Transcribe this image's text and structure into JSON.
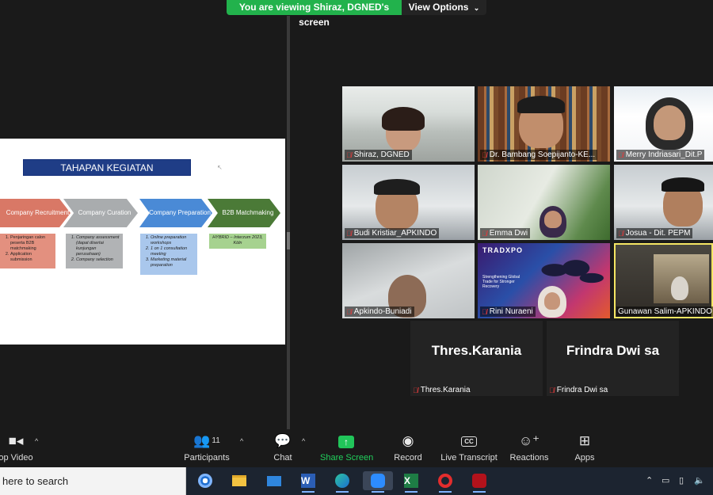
{
  "banner": {
    "viewing_text": "You are viewing Shiraz, DGNED's screen",
    "view_options": "View Options"
  },
  "slide": {
    "title": "TAHAPAN KEGIATAN",
    "steps": [
      {
        "label": "Company Recruitment",
        "color": "#d97866"
      },
      {
        "label": "Company Curation",
        "color": "#a9acae"
      },
      {
        "label": "Company Preparation",
        "color": "#4a8ad6"
      },
      {
        "label": "B2B Matchmaking",
        "color": "#4b7a37"
      }
    ],
    "step1_items": [
      "Penjaringan calon peserta B2B matchmaking",
      "Application submission"
    ],
    "step2_items": [
      "Company assessment (dapat disertai kunjungan perusahaan)",
      "Company selection"
    ],
    "step3_items": [
      "Online preparation workshops",
      "1 on 1 consultation meeting",
      "Marketing material preparation"
    ],
    "step4_text": "HYBRID – Interzum 2023, Köln"
  },
  "participants": [
    {
      "name": "Shiraz, DGNED"
    },
    {
      "name": "Dr. Bambang Soepijanto-KE..."
    },
    {
      "name": "Merry Indriasari_Dit.P"
    },
    {
      "name": "Budi Kristiar_APKINDO"
    },
    {
      "name": "Emma Dwi"
    },
    {
      "name": "Josua - Dit. PEPM"
    },
    {
      "name": "Apkindo-Buniadi"
    },
    {
      "name": "Rini Nuraeni"
    },
    {
      "name": "Gunawan Salim-APKINDO"
    },
    {
      "name": "Thres.Karania"
    },
    {
      "name": "Frindra Dwi sa"
    }
  ],
  "tradexpo": {
    "logo": "TRADXPO",
    "tagline": "Strengthening Global Trade for Stronger Recovery"
  },
  "toolbar": {
    "stop_video": "op Video",
    "participants": "Participants",
    "participants_count": "11",
    "chat": "Chat",
    "share_screen": "Share Screen",
    "record": "Record",
    "live_transcript": "Live Transcript",
    "reactions": "Reactions",
    "apps": "Apps",
    "cc": "CC"
  },
  "taskbar": {
    "search_text": "here to search",
    "word": "W",
    "excel": "X",
    "opera": "O"
  },
  "colors": {
    "banner_green": "#22b24c",
    "share_green": "#21c55a",
    "active_speaker": "#f5e663",
    "slide_title_bg": "#1f3d86"
  }
}
